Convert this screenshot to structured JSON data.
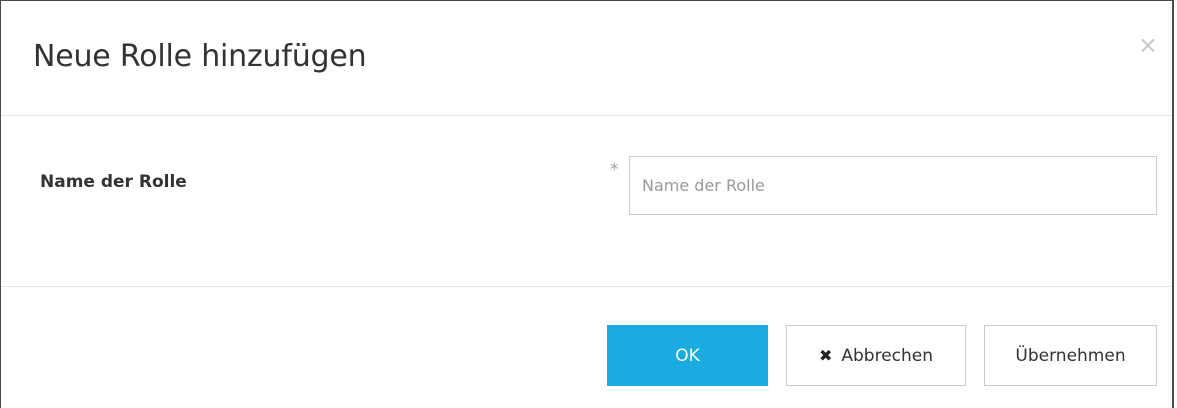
{
  "dialog": {
    "title": "Neue Rolle hinzufügen",
    "close_icon": "×"
  },
  "form": {
    "name_label": "Name der Rolle",
    "required_marker": "*",
    "name_placeholder": "Name der Rolle",
    "name_value": ""
  },
  "buttons": {
    "ok_label": "OK",
    "cancel_icon": "✖",
    "cancel_label": "Abbrechen",
    "apply_label": "Übernehmen"
  },
  "colors": {
    "primary": "#1aace0"
  }
}
